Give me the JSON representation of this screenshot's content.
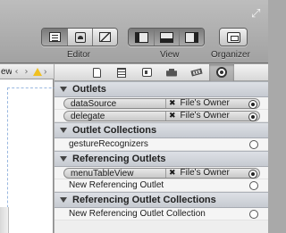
{
  "toolbar": {
    "editor_label": "Editor",
    "view_label": "View",
    "organizer_label": "Organizer",
    "editor_modes": [
      "standard-editor-icon",
      "assistant-editor-icon",
      "version-editor-icon"
    ],
    "view_modes": [
      "navigator-panel-icon",
      "debug-panel-icon",
      "utilities-panel-icon"
    ],
    "active_view_modes": [
      true,
      true,
      true
    ]
  },
  "left_pane": {
    "bar_text": "ew",
    "nav_back": "‹",
    "nav_forward": "›",
    "separator": "›"
  },
  "inspector": {
    "active_tab": "connections",
    "sections": {
      "outlets": {
        "title": "Outlets",
        "rows": [
          {
            "name": "dataSource",
            "target": "File's Owner"
          },
          {
            "name": "delegate",
            "target": "File's Owner"
          }
        ]
      },
      "outlet_collections": {
        "title": "Outlet Collections",
        "rows": [
          {
            "name": "gestureRecognizers"
          }
        ]
      },
      "referencing_outlets": {
        "title": "Referencing Outlets",
        "connected": {
          "name": "menuTableView",
          "target": "File's Owner"
        },
        "new_label": "New Referencing Outlet"
      },
      "referencing_outlet_collections": {
        "title": "Referencing Outlet Collections",
        "new_label": "New Referencing Outlet Collection"
      }
    }
  },
  "colors": {
    "toolbar_bg": "#b0b0b0",
    "section_header_bg": "#d1d4da",
    "inspector_bg": "#eeeeee",
    "warning": "#f0c020"
  }
}
